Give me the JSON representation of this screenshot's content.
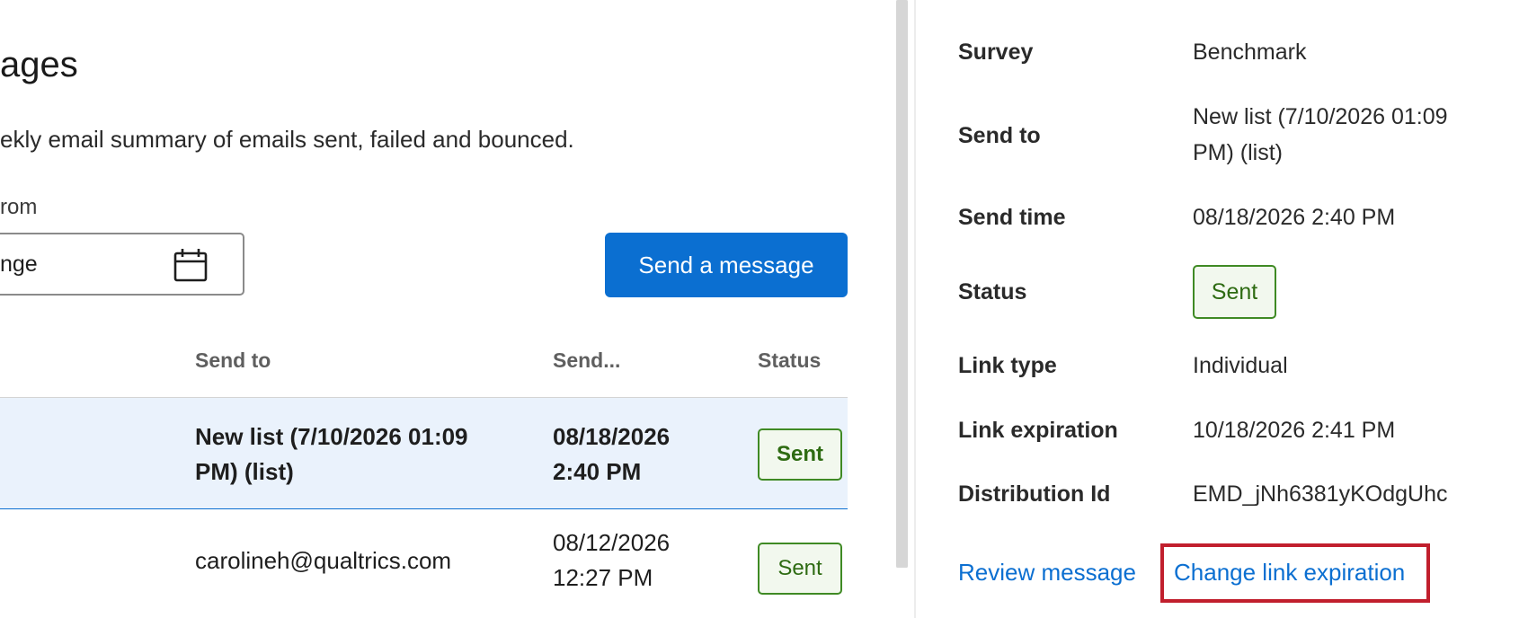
{
  "main": {
    "title": "ages",
    "description": "ekly email summary of emails sent, failed and bounced.",
    "date_filter": {
      "label": "rom",
      "value": "nge"
    },
    "send_button_label": "Send a message",
    "table": {
      "headers": {
        "send_to": "Send to",
        "send_time": "Send...",
        "status": "Status"
      },
      "rows": [
        {
          "send_to_line1": "New list (7/10/2026 01:09",
          "send_to_line2": "PM) (list)",
          "send_time_line1": "08/18/2026",
          "send_time_line2": "2:40 PM",
          "status": "Sent"
        },
        {
          "send_to_line1": "carolineh@qualtrics.com",
          "send_time_line1": "08/12/2026",
          "send_time_line2": "12:27 PM",
          "status": "Sent"
        }
      ]
    }
  },
  "details": {
    "survey_label": "Survey",
    "survey_value": "Benchmark",
    "send_to_label": "Send to",
    "send_to_value_line1": "New list (7/10/2026 01:09",
    "send_to_value_line2": "PM) (list)",
    "send_time_label": "Send time",
    "send_time_value": "08/18/2026 2:40 PM",
    "status_label": "Status",
    "status_value": "Sent",
    "link_type_label": "Link type",
    "link_type_value": "Individual",
    "link_expiration_label": "Link expiration",
    "link_expiration_value": "10/18/2026 2:41 PM",
    "distribution_id_label": "Distribution Id",
    "distribution_id_value": "EMD_jNh6381yKOdgUhc",
    "review_message_link": "Review message",
    "change_link_expiration_link": "Change link expiration"
  },
  "colors": {
    "primary_blue": "#0b6fd1",
    "selected_row_bg": "#eaf2fc",
    "sent_green": "#2e6b12",
    "sent_bg": "#f2f8ee",
    "highlight_red": "#c11f2d"
  },
  "icons": {
    "date_picker": "calendar-icon"
  }
}
